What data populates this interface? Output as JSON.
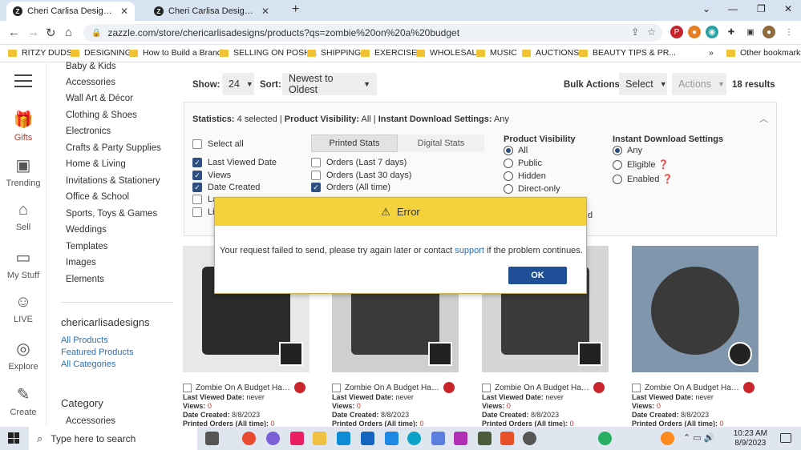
{
  "browser": {
    "tabs": [
      {
        "title": "Cheri Carlisa Designs: products o",
        "favicon": "Z"
      },
      {
        "title": "Cheri Carlisa Designs: products o",
        "favicon": "Z"
      }
    ],
    "new_tab": "+",
    "url": "zazzle.com/store/chericarlisadesigns/products?qs=zombie%20on%20a%20budget",
    "bookmarks": [
      "RITZY DUDS",
      "DESIGNING",
      "How to Build a Brand",
      "SELLING ON POSH...",
      "SHIPPING",
      "EXERCISE",
      "WHOLESALE",
      "MUSIC",
      "AUCTIONS",
      "BEAUTY TIPS & PR..."
    ],
    "more_bookmarks": "»",
    "other_bookmarks": "Other bookmarks"
  },
  "leftnav": [
    {
      "label": "Gifts",
      "icon": "gift-icon",
      "glyph": "🎁",
      "color": "#c0392b"
    },
    {
      "label": "Trending",
      "icon": "trending-icon",
      "glyph": "☐",
      "color": "#555"
    },
    {
      "label": "Sell",
      "icon": "sell-icon",
      "glyph": "⌂",
      "color": "#555"
    },
    {
      "label": "My Stuff",
      "icon": "my-stuff-icon",
      "glyph": "▭",
      "color": "#555"
    },
    {
      "label": "LIVE",
      "icon": "live-icon",
      "glyph": "☺",
      "color": "#555"
    },
    {
      "label": "Explore",
      "icon": "explore-icon",
      "glyph": "◎",
      "color": "#555"
    },
    {
      "label": "Create",
      "icon": "create-icon",
      "glyph": "✎",
      "color": "#555"
    }
  ],
  "categories": [
    "Baby & Kids",
    "Accessories",
    "Wall Art & Décor",
    "Clothing & Shoes",
    "Electronics",
    "Crafts & Party Supplies",
    "Home & Living",
    "Invitations & Stationery",
    "Office & School",
    "Sports, Toys & Games",
    "Weddings",
    "Templates",
    "Images",
    "Elements"
  ],
  "store": {
    "name": "chericarlisadesigns",
    "links": [
      "All Products",
      "Featured Products",
      "All Categories"
    ],
    "category_heading": "Category",
    "category_first": "Accessories"
  },
  "toolbar": {
    "show_label": "Show:",
    "show_value": "24",
    "sort_label": "Sort:",
    "sort_value": "Newest to Oldest",
    "bulk_label": "Bulk Actions:",
    "select_label": "Select",
    "actions_label": "Actions",
    "results": "18 results"
  },
  "stats": {
    "summary_prefix": "Statistics:",
    "summary_text": "4 selected |",
    "visibility_label": "Product Visibility:",
    "visibility_value": "All |",
    "download_label": "Instant Download Settings:",
    "download_value": "Any",
    "select_all": "Select all",
    "col1": [
      {
        "label": "Last Viewed Date",
        "checked": true
      },
      {
        "label": "Views",
        "checked": true
      },
      {
        "label": "Date Created",
        "checked": true
      },
      {
        "label": "La",
        "checked": false
      },
      {
        "label": "Li",
        "checked": false
      }
    ],
    "tabs": [
      "Printed Stats",
      "Digital Stats"
    ],
    "col2": [
      {
        "label": "Orders (Last 7 days)",
        "checked": false
      },
      {
        "label": "Orders (Last 30 days)",
        "checked": false
      },
      {
        "label": "Orders (All time)",
        "checked": true
      }
    ],
    "visibility_heading": "Product Visibility",
    "visibility_options": [
      {
        "label": "All",
        "selected": true
      },
      {
        "label": "Public",
        "selected": false
      },
      {
        "label": "Hidden",
        "selected": false
      },
      {
        "label": "Direct-only",
        "selected": false
      }
    ],
    "download_heading": "Instant Download Settings",
    "download_options": [
      {
        "label": "Any",
        "selected": true
      },
      {
        "label": "Eligible",
        "selected": false
      },
      {
        "label": "Enabled",
        "selected": false
      }
    ],
    "partial_text": "d"
  },
  "products": [
    {
      "title": "Zombie On A Budget Hallowee...",
      "viewed": "never",
      "views": "0",
      "created": "8/8/2023",
      "orders": "0",
      "bg": "#e8e8e8"
    },
    {
      "title": "Zombie On A Budget Hallowee...",
      "viewed": "never",
      "views": "0",
      "created": "8/8/2023",
      "orders": "0",
      "bg": "#cfcfcf"
    },
    {
      "title": "Zombie On A Budget Hallowee...",
      "viewed": "never",
      "views": "0",
      "created": "8/8/2023",
      "orders": "0",
      "bg": "#d6d6d6"
    },
    {
      "title": "Zombie On A Budget Hallowee...",
      "viewed": "never",
      "views": "0",
      "created": "8/8/2023",
      "orders": "0",
      "bg": "#7f96ad"
    }
  ],
  "product_labels": {
    "viewed": "Last Viewed Date:",
    "views": "Views:",
    "created": "Date Created:",
    "orders": "Printed Orders (All time):"
  },
  "modal": {
    "title": "Error",
    "message_before": "Your request failed to send, please try again later or contact",
    "link": "support",
    "message_after": "if the problem continues.",
    "ok": "OK"
  },
  "taskbar": {
    "search_placeholder": "Type here to search",
    "time": "10:23 AM",
    "date": "8/9/2023"
  }
}
